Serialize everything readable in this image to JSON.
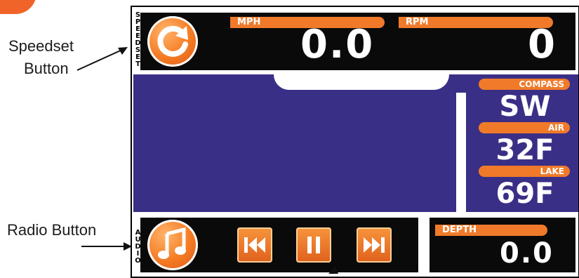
{
  "callouts": {
    "speedset_line1": "Speedset",
    "speedset_line2": "Button",
    "radio": "Radio Button"
  },
  "side_labels": {
    "top": "SPEEDSET",
    "bottom": "AUDIO"
  },
  "gauges": {
    "mph_label": "MPH",
    "mph_value": "0.0",
    "rpm_label": "RPM",
    "rpm_value": "0"
  },
  "stats": {
    "compass_label": "COMPASS",
    "compass_value": "SW",
    "air_label": "AIR",
    "air_value": "32F",
    "lake_label": "LAKE",
    "lake_value": "69F"
  },
  "depth": {
    "label": "DEPTH",
    "value": "0.0"
  },
  "icons": {
    "speedset": "refresh-icon",
    "radio": "music-note-icon",
    "prev": "rewind-icon",
    "pause": "pause-icon",
    "next": "fast-forward-icon"
  },
  "colors": {
    "accent": "#f07a2a",
    "screen": "#3a2f86",
    "panel": "#0a0a0a"
  }
}
